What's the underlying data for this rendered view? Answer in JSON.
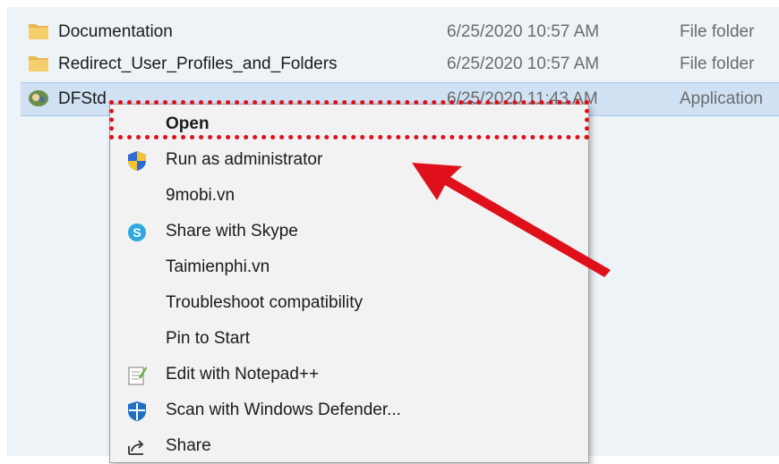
{
  "files": [
    {
      "name": "Documentation",
      "date": "6/25/2020 10:57 AM",
      "type": "File folder",
      "icon": "folder-icon"
    },
    {
      "name": "Redirect_User_Profiles_and_Folders",
      "date": "6/25/2020 10:57 AM",
      "type": "File folder",
      "icon": "folder-icon"
    },
    {
      "name": "DFStd",
      "date": "6/25/2020 11:43 AM",
      "type": "Application",
      "icon": "application-icon"
    }
  ],
  "context_menu": {
    "items": [
      {
        "label": "Open",
        "icon": ""
      },
      {
        "label": "Run as administrator",
        "icon": "uac-shield-icon"
      },
      {
        "label": "9mobi.vn",
        "icon": ""
      },
      {
        "label": "Share with Skype",
        "icon": "skype-icon"
      },
      {
        "label": "Taimienphi.vn",
        "icon": ""
      },
      {
        "label": "Troubleshoot compatibility",
        "icon": ""
      },
      {
        "label": "Pin to Start",
        "icon": ""
      },
      {
        "label": "Edit with Notepad++",
        "icon": "notepad-plus-plus-icon"
      },
      {
        "label": "Scan with Windows Defender...",
        "icon": "windows-defender-icon"
      },
      {
        "label": "Share",
        "icon": "share-icon"
      }
    ]
  },
  "colors": {
    "highlight": "#e0101a",
    "selection": "#cfe1f3",
    "folder": "#e8b84a"
  }
}
